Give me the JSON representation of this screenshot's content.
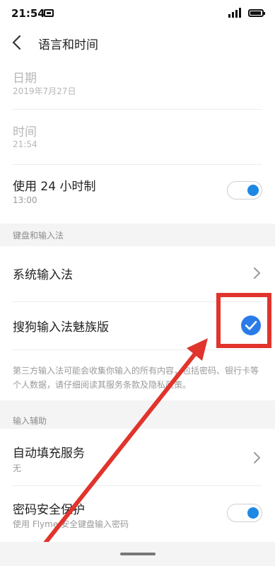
{
  "status_bar": {
    "time": "21:54"
  },
  "header": {
    "title": "语言和时间"
  },
  "rows": {
    "date": {
      "title": "日期",
      "subtitle": "2019年7月27日"
    },
    "time": {
      "title": "时间",
      "subtitle": "21:54"
    },
    "hour24": {
      "title": "使用 24 小时制",
      "subtitle": "13:00",
      "on": true
    }
  },
  "keyboard_section": {
    "label": "键盘和输入法",
    "system_ime": "系统输入法",
    "sogou_ime": "搜狗输入法魅族版",
    "sogou_checked": true,
    "note": "第三方输入法可能会收集你输入的所有内容，包括密码、银行卡等个人数据，请仔细阅读其服务条款及隐私政策。"
  },
  "assist_section": {
    "label": "输入辅助",
    "autofill": {
      "title": "自动填充服务",
      "subtitle": "无"
    },
    "password": {
      "title": "密码安全保护",
      "subtitle": "使用 Flyme 安全键盘输入密码",
      "on": true
    }
  },
  "colors": {
    "accent": "#1e88e5",
    "highlight": "#e0342c"
  }
}
